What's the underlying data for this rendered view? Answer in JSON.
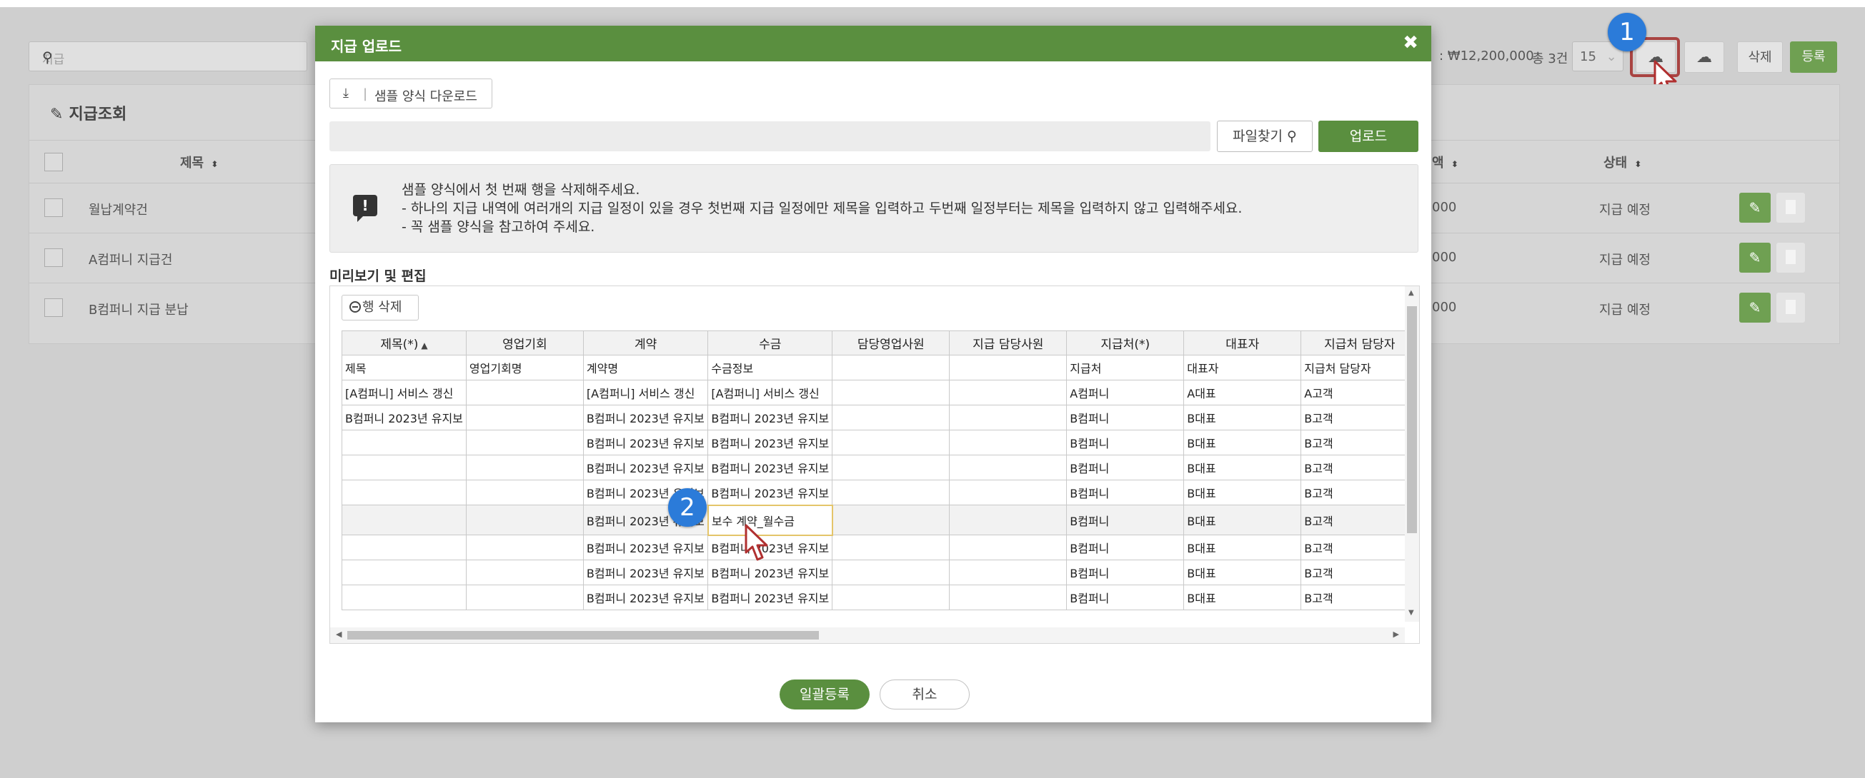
{
  "background": {
    "search_placeholder": "지급",
    "summary_amount": ": ₩12,200,000",
    "summary_count": "총 3건",
    "page_size": "15",
    "delete_label": "삭제",
    "register_label": "등록",
    "panel_title": "지급조회",
    "headers": {
      "title": "제목",
      "amount_tail": "액",
      "status": "상태"
    },
    "rows": [
      {
        "title": "월납계약건",
        "amount_tail": "000",
        "status": "지급 예정"
      },
      {
        "title": "A컴퍼니 지급건",
        "amount_tail": "000",
        "status": "지급 예정"
      },
      {
        "title": "B컴퍼니 지급 분납",
        "amount_tail": "000",
        "status": "지급 예정"
      }
    ]
  },
  "badges": {
    "one": "1",
    "two": "2"
  },
  "modal": {
    "title": "지급 업로드",
    "close_glyph": "✖",
    "download_sample": "샘플 양식 다운로드",
    "find_file": "파일찾기",
    "upload": "업로드",
    "notices": [
      "샘플 양식에서 첫 번째 행을 삭제해주세요.",
      "- 하나의 지급 내역에 여러개의 지급 일정이 있을 경우 첫번째 지급 일정에만 제목을 입력하고 두번째 일정부터는 제목을 입력하지 않고 입력해주세요.",
      "- 꼭 샘플 양식을 참고하여 주세요."
    ],
    "preview_title": "미리보기 및 편집",
    "row_delete": "행 삭제",
    "columns": [
      "제목(*)",
      "영업기회",
      "계약",
      "수금",
      "담당영업사원",
      "지급 담당사원",
      "지급처(*)",
      "대표자",
      "지급처 담당자"
    ],
    "subheaders": [
      "제목",
      "영업기회명",
      "계약명",
      "수금정보",
      "",
      "",
      "지급처",
      "대표자",
      "지급처 담당자"
    ],
    "rows": [
      [
        "[A컴퍼니] 서비스 갱신",
        "",
        "[A컴퍼니] 서비스 갱신",
        "[A컴퍼니] 서비스 갱신",
        "",
        "",
        "A컴퍼니",
        "A대표",
        "A고객"
      ],
      [
        "B컴퍼니 2023년 유지보",
        "",
        "B컴퍼니 2023년 유지보",
        "B컴퍼니 2023년 유지보",
        "",
        "",
        "B컴퍼니",
        "B대표",
        "B고객"
      ],
      [
        "",
        "",
        "B컴퍼니 2023년 유지보",
        "B컴퍼니 2023년 유지보",
        "",
        "",
        "B컴퍼니",
        "B대표",
        "B고객"
      ],
      [
        "",
        "",
        "B컴퍼니 2023년 유지보",
        "B컴퍼니 2023년 유지보",
        "",
        "",
        "B컴퍼니",
        "B대표",
        "B고객"
      ],
      [
        "",
        "",
        "B컴퍼니 2023년 유지보",
        "B컴퍼니 2023년 유지보",
        "",
        "",
        "B컴퍼니",
        "B대표",
        "B고객"
      ],
      [
        "",
        "",
        "B컴퍼니 2023년 유지보",
        "보수 계약_월수금",
        "",
        "",
        "B컴퍼니",
        "B대표",
        "B고객"
      ],
      [
        "",
        "",
        "B컴퍼니 2023년 유지보",
        "B컴퍼니 2023년 유지보",
        "",
        "",
        "B컴퍼니",
        "B대표",
        "B고객"
      ],
      [
        "",
        "",
        "B컴퍼니 2023년 유지보",
        "B컴퍼니 2023년 유지보",
        "",
        "",
        "B컴퍼니",
        "B대표",
        "B고객"
      ],
      [
        "",
        "",
        "B컴퍼니 2023년 유지보",
        "B컴퍼니 2023년 유지보",
        "",
        "",
        "B컴퍼니",
        "B대표",
        "B고객"
      ]
    ],
    "active_row": 5,
    "editing_col": 3,
    "bulk_register": "일괄등록",
    "cancel": "취소"
  },
  "colors": {
    "primary_green": "#5a8f3f",
    "badge_blue": "#2b7bd9",
    "highlight_red": "#a94442"
  }
}
